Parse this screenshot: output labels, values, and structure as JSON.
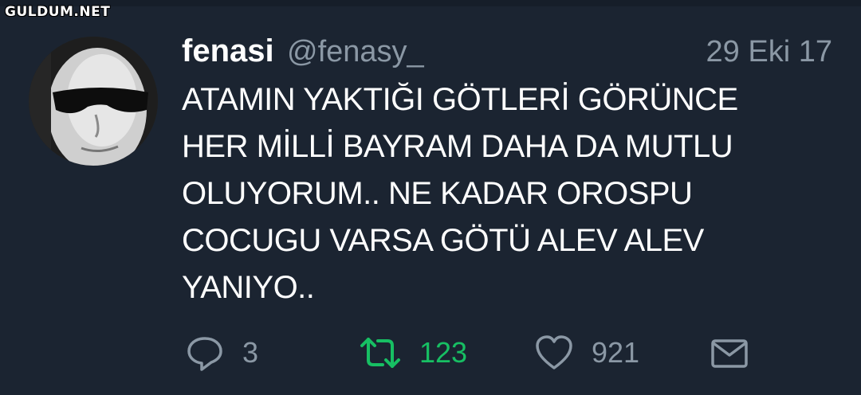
{
  "watermark": "GULDUM.NET",
  "tweet": {
    "display_name": "fenasi",
    "handle": "@fenasy_",
    "timestamp": "29 Eki 17",
    "text_lines": [
      "ATAMIN YAKTIĞI GÖTLERİ GÖRÜNCE",
      "HER MİLLİ BAYRAM DAHA DA MUTLU",
      "OLUYORUM.. NE KADAR OROSPU",
      "COCUGU VARSA GÖTÜ ALEV ALEV",
      "YANIYO.."
    ]
  },
  "actions": {
    "reply": {
      "icon": "reply-icon",
      "count": "3"
    },
    "retweet": {
      "icon": "retweet-icon",
      "count": "123",
      "color": "#17bf63"
    },
    "like": {
      "icon": "heart-icon",
      "count": "921"
    },
    "dm": {
      "icon": "envelope-icon"
    }
  },
  "colors": {
    "background": "#1b2431",
    "muted_text": "#8b98a5",
    "retweet_active": "#17bf63"
  }
}
